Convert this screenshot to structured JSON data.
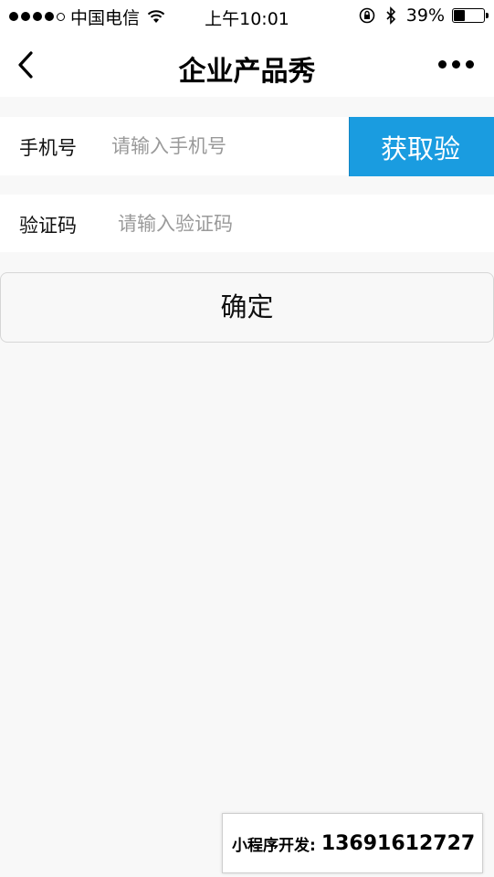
{
  "status_bar": {
    "carrier": "中国电信",
    "time": "上午10:01",
    "battery": "39%",
    "battery_level": 0.39,
    "signal_bars": 4,
    "signal_max": 5
  },
  "nav": {
    "title": "企业产品秀",
    "back_icon": "chevron-left-icon",
    "more_icon": "more-dots-icon"
  },
  "form": {
    "phone": {
      "label": "手机号",
      "placeholder": "请输入手机号",
      "value": ""
    },
    "get_code_label": "获取验",
    "code": {
      "label": "验证码",
      "placeholder": "请输入验证码",
      "value": ""
    },
    "confirm_label": "确定"
  },
  "colors": {
    "accent": "#1a9ce0",
    "background": "#f8f8f8"
  },
  "watermark": {
    "label": "小程序开发:",
    "number": "13691612727"
  }
}
